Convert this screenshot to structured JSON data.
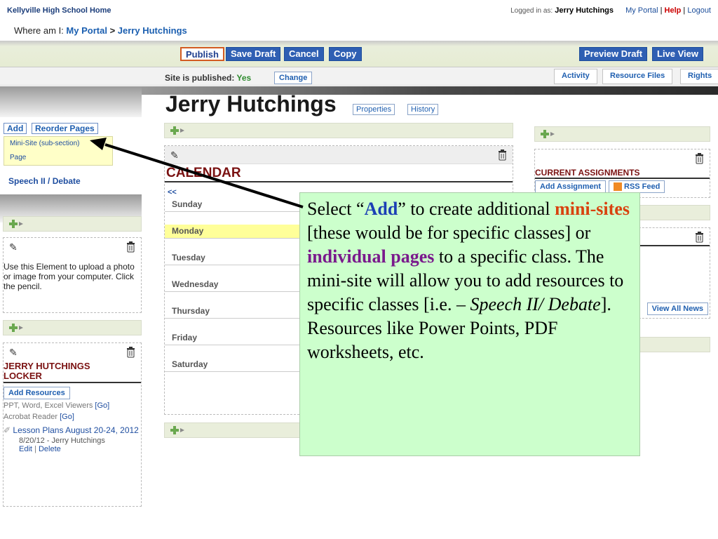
{
  "top": {
    "school_home": "Kellyville High School Home",
    "logged_in_label": "Logged in as:",
    "user": "Jerry Hutchings",
    "my_portal": "My Portal",
    "sep1": "|",
    "help": "Help",
    "sep2": "|",
    "logout": "Logout"
  },
  "breadcrumb": {
    "prefix": "Where am I:",
    "portal": "My Portal",
    "arrow": ">",
    "current": "Jerry Hutchings"
  },
  "toolbar": {
    "publish": "Publish",
    "save_draft": "Save Draft",
    "cancel": "Cancel",
    "copy": "Copy",
    "preview_draft": "Preview Draft",
    "live_view": "Live View"
  },
  "status": {
    "published_label": "Site is published:",
    "published_value": "Yes",
    "change": "Change",
    "tabs": [
      "Activity",
      "Resource Files",
      "Rights"
    ]
  },
  "page": {
    "title": "Jerry Hutchings",
    "properties": "Properties",
    "history": "History"
  },
  "left": {
    "add": "Add",
    "reorder": "Reorder Pages",
    "menu": [
      "Mini-Site (sub-section)",
      "Page"
    ],
    "nav_link": "Speech II / Debate",
    "upload_text": "Use this Element to upload a photo or image from your computer. Click the pencil.",
    "locker_title": "JERRY HUTCHINGS LOCKER",
    "add_resources": "Add Resources",
    "viewers": "PPT, Word, Excel Viewers",
    "acrobat": "Acrobat Reader",
    "go": "[Go]",
    "lesson_plans": "Lesson Plans August 20-24, 2012",
    "lesson_meta": "8/20/12 - Jerry Hutchings",
    "edit": "Edit",
    "sep": "|",
    "delete": "Delete"
  },
  "calendar": {
    "title": "CALENDAR",
    "prev": "<<",
    "days": [
      "Sunday",
      "Monday",
      "Tuesday",
      "Wednesday",
      "Thursday",
      "Friday",
      "Saturday"
    ],
    "today_index": 1
  },
  "right": {
    "assignments_title": "CURRENT ASSIGNMENTS",
    "add_assignment": "Add Assignment",
    "rss_feed": "RSS Feed",
    "view_all_news": "View All News"
  },
  "callout": {
    "p1": "Select “",
    "add": "Add",
    "p2": "” to create additional ",
    "mini_sites": "mini-sites",
    "p3": " [these would be for specific classes] or ",
    "individual_pages": "individual pages",
    "p4": " to a specific class.  The mini-site will allow you to add resources to specific classes [i.e. – ",
    "speech": "Speech II/ Debate",
    "p5": "].  Resources like Power Points, PDF worksheets, etc."
  },
  "colors": {
    "link_blue": "#1b4d9a",
    "button_blue": "#2f5fb3",
    "publish_border": "#d35b22",
    "section_title": "#7a1111",
    "callout_bg": "#ccffcc",
    "today_highlight": "#ffff99"
  }
}
